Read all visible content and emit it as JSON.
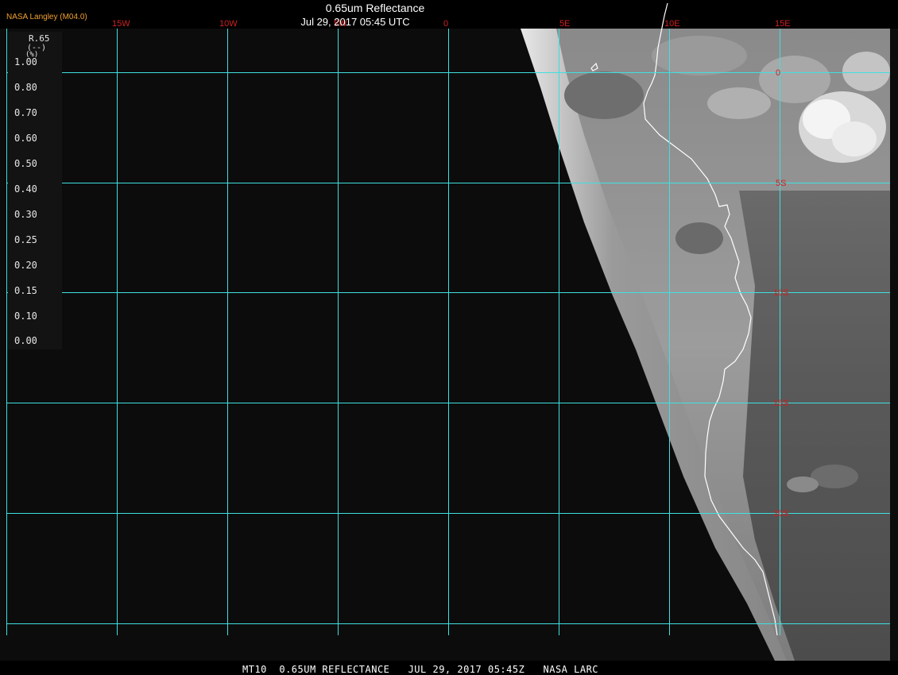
{
  "header": {
    "agency": "NASA Langley (M04.0)",
    "title": "0.65um Reflectance",
    "subtitle": "Jul 29, 2017 05:45 UTC"
  },
  "legend": {
    "variable": "R.65",
    "unit": "(--)",
    "unit_glyph": "(%)",
    "ticks": [
      "1.00",
      "0.80",
      "0.70",
      "0.60",
      "0.50",
      "0.40",
      "0.30",
      "0.25",
      "0.20",
      "0.15",
      "0.10",
      "0.00"
    ],
    "ramp_colors": [
      "#ffffff",
      "#f0f0f0",
      "#dcdcdc",
      "#c8c8c8",
      "#b4b4b4",
      "#a0a0a0",
      "#8c8c8c",
      "#787878",
      "#646464",
      "#505050",
      "#3c3c3c",
      "#282828",
      "#141414"
    ]
  },
  "map": {
    "longitude_labels": [
      "15W",
      "10W",
      "5W",
      "0",
      "5E",
      "10E",
      "15E"
    ],
    "latitude_labels": [
      "0",
      "5S",
      "10S",
      "15S",
      "20S"
    ],
    "grid_color": "#40e0e0",
    "label_color": "#d02020",
    "ocean_color": "#0c0c0c",
    "coastline_color": "#ffffff"
  },
  "footer": {
    "caption": "MT10  0.65UM REFLECTANCE   JUL 29, 2017 05:45Z   NASA LARC"
  }
}
